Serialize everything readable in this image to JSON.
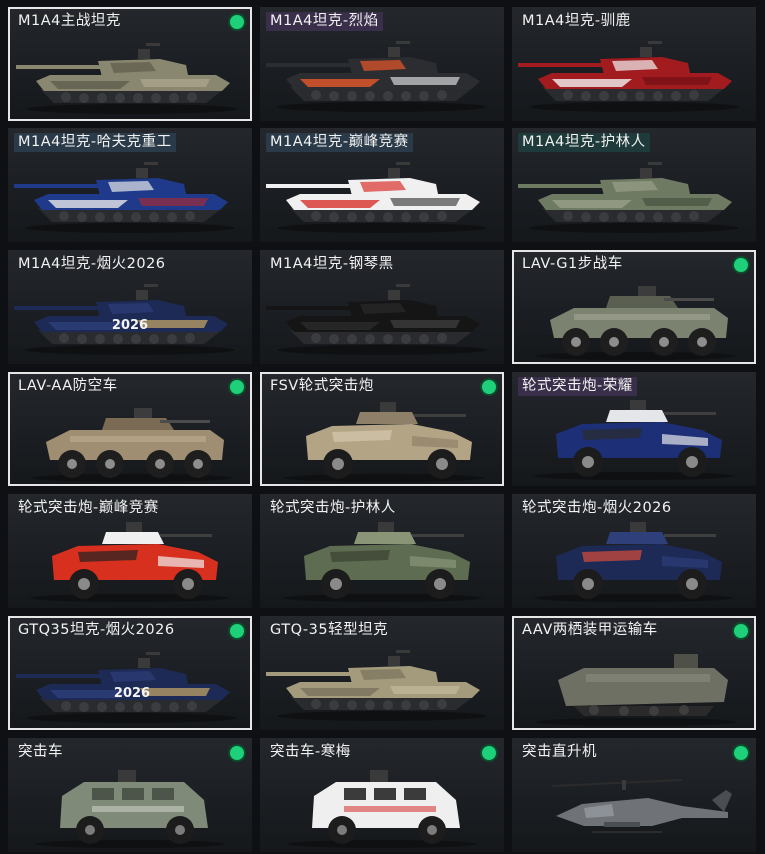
{
  "items": [
    {
      "name": "M1A4主战坦克",
      "selected": true,
      "owned": true,
      "highlight": "none",
      "kind": "tank",
      "colors": [
        "#8a8770",
        "#5e5d4c",
        "#b4ae92"
      ]
    },
    {
      "name": "M1A4坦克-烈焰",
      "selected": false,
      "owned": false,
      "highlight": "purple",
      "kind": "tank",
      "colors": [
        "#2c2d31",
        "#e8572a",
        "#f2f2f2"
      ]
    },
    {
      "name": "M1A4坦克-驯鹿",
      "selected": false,
      "owned": false,
      "highlight": "none",
      "kind": "tank",
      "colors": [
        "#a11b1f",
        "#f2f2f2",
        "#6a0f12"
      ]
    },
    {
      "name": "M1A4坦克-哈夫克重工",
      "selected": false,
      "owned": false,
      "highlight": "blue",
      "kind": "tank",
      "colors": [
        "#1f3a8a",
        "#e7e7ea",
        "#b5282d"
      ]
    },
    {
      "name": "M1A4坦克-巅峰竞赛",
      "selected": false,
      "owned": false,
      "highlight": "blue",
      "kind": "tank",
      "colors": [
        "#f0f0f0",
        "#d9322c",
        "#2b2b2b"
      ]
    },
    {
      "name": "M1A4坦克-护林人",
      "selected": false,
      "owned": false,
      "highlight": "teal",
      "kind": "tank",
      "colors": [
        "#6f7a63",
        "#9aa08a",
        "#3f4a3b"
      ]
    },
    {
      "name": "M1A4坦克-烟火2026",
      "selected": false,
      "owned": false,
      "highlight": "none",
      "kind": "tank2026",
      "colors": [
        "#1c2a55",
        "#2e3f7a",
        "#e6c06a"
      ]
    },
    {
      "name": "M1A4坦克-钢琴黑",
      "selected": false,
      "owned": false,
      "highlight": "none",
      "kind": "tank",
      "colors": [
        "#151515",
        "#2a2a2a",
        "#4a4a4a"
      ]
    },
    {
      "name": "LAV-G1步战车",
      "selected": true,
      "owned": true,
      "highlight": "none",
      "kind": "lav",
      "colors": [
        "#7c8270",
        "#5a5f51",
        "#a9ad9c"
      ]
    },
    {
      "name": "LAV-AA防空车",
      "selected": true,
      "owned": true,
      "highlight": "none",
      "kind": "lav",
      "colors": [
        "#a08e72",
        "#7b6b54",
        "#c5b497"
      ]
    },
    {
      "name": "FSV轮式突击炮",
      "selected": true,
      "owned": true,
      "highlight": "none",
      "kind": "fsv",
      "colors": [
        "#b4a486",
        "#8e8068",
        "#d4c8ad"
      ]
    },
    {
      "name": "轮式突击炮-荣耀",
      "selected": false,
      "owned": false,
      "highlight": "purple",
      "kind": "fsv",
      "colors": [
        "#1d2f76",
        "#e4e6ea",
        "#2b2b2b"
      ]
    },
    {
      "name": "轮式突击炮-巅峰竞赛",
      "selected": false,
      "owned": false,
      "highlight": "none",
      "kind": "fsv",
      "colors": [
        "#d7301f",
        "#f0f0f0",
        "#222222"
      ]
    },
    {
      "name": "轮式突击炮-护林人",
      "selected": false,
      "owned": false,
      "highlight": "none",
      "kind": "fsv",
      "colors": [
        "#5e6d52",
        "#8a9577",
        "#394231"
      ]
    },
    {
      "name": "轮式突击炮-烟火2026",
      "selected": false,
      "owned": false,
      "highlight": "none",
      "kind": "fsv",
      "colors": [
        "#1c2a55",
        "#2e3f7a",
        "#d94c3a"
      ]
    },
    {
      "name": "GTQ35坦克-烟火2026",
      "selected": true,
      "owned": true,
      "highlight": "none",
      "kind": "tank2026",
      "colors": [
        "#1c2a55",
        "#2e3f7a",
        "#e6c06a"
      ]
    },
    {
      "name": "GTQ-35轻型坦克",
      "selected": false,
      "owned": false,
      "highlight": "none",
      "kind": "tank",
      "colors": [
        "#a49a7c",
        "#7a725c",
        "#c9c0a2"
      ]
    },
    {
      "name": "AAV两栖装甲运输车",
      "selected": true,
      "owned": true,
      "highlight": "none",
      "kind": "aav",
      "colors": [
        "#6e7064",
        "#4f5148",
        "#8e9082"
      ]
    },
    {
      "name": "突击车",
      "selected": false,
      "owned": true,
      "highlight": "none",
      "kind": "truck",
      "colors": [
        "#7f8a78",
        "#c9cdc3",
        "#4d5449"
      ]
    },
    {
      "name": "突击车-寒梅",
      "selected": false,
      "owned": true,
      "highlight": "none",
      "kind": "truck",
      "colors": [
        "#efefef",
        "#d53c3c",
        "#3b3b3b"
      ]
    },
    {
      "name": "突击直升机",
      "selected": false,
      "owned": true,
      "highlight": "none",
      "kind": "heli",
      "colors": [
        "#6f7378",
        "#4a4e53",
        "#9aa0a6"
      ]
    }
  ],
  "badge_2026": "2026"
}
